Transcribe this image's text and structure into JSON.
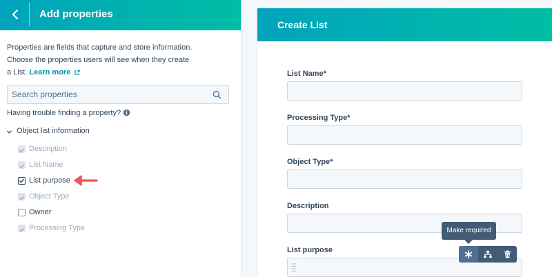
{
  "left_panel": {
    "title": "Add properties",
    "description": "Properties are fields that capture and store information. Choose the properties users will see when they create a List.",
    "learn_more": "Learn more",
    "search_placeholder": "Search properties",
    "trouble_text": "Having trouble finding a property?",
    "group_label": "Object list information",
    "properties": [
      {
        "label": "Description",
        "state": "disabled-checked"
      },
      {
        "label": "List Name",
        "state": "disabled-checked"
      },
      {
        "label": "List purpose",
        "state": "checked"
      },
      {
        "label": "Object Type",
        "state": "disabled-checked"
      },
      {
        "label": "Owner",
        "state": "unchecked"
      },
      {
        "label": "Processing Type",
        "state": "disabled-checked"
      }
    ]
  },
  "form": {
    "title": "Create List",
    "fields": [
      {
        "label": "List Name*"
      },
      {
        "label": "Processing Type*"
      },
      {
        "label": "Object Type*"
      },
      {
        "label": "Description"
      },
      {
        "label": "List purpose"
      }
    ]
  },
  "toolbar": {
    "tooltip": "Make required",
    "buttons": [
      "asterisk-icon",
      "dependency-icon",
      "trash-icon"
    ]
  },
  "colors": {
    "header_start": "#00a4bd",
    "header_end": "#00bda5",
    "accent_link": "#0091ae",
    "arrow": "#f2545b",
    "toolbar_bg": "#425b76"
  }
}
